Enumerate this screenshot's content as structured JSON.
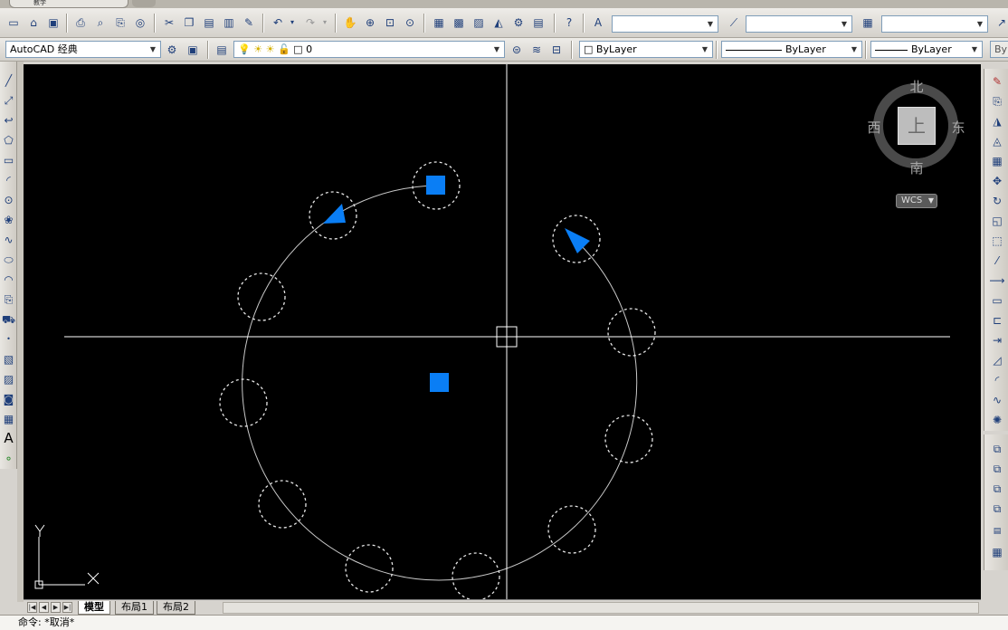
{
  "title": {
    "doc_tab": "教学"
  },
  "toolbar": {
    "workspace": "AutoCAD 经典",
    "layer": "0",
    "color": "ByLayer",
    "linetype": "ByLayer",
    "lineweight": "ByLayer",
    "plotstyle": "By"
  },
  "viewcube": {
    "north": "北",
    "south": "南",
    "east": "东",
    "west": "西",
    "face": "上",
    "wcs": "WCS"
  },
  "ucs": {
    "x": "X",
    "y": "Y"
  },
  "left_toolbar": {
    "text_tool": "A"
  },
  "layout_tabs": [
    {
      "label": "模型"
    },
    {
      "label": "布局1"
    },
    {
      "label": "布局2"
    }
  ],
  "command": {
    "line": "命令: *取消*"
  },
  "colors": {
    "background": "#000000",
    "grip": "#0a7ef5",
    "arc": "#c8c8c8",
    "crosshair": "#ffffff"
  }
}
